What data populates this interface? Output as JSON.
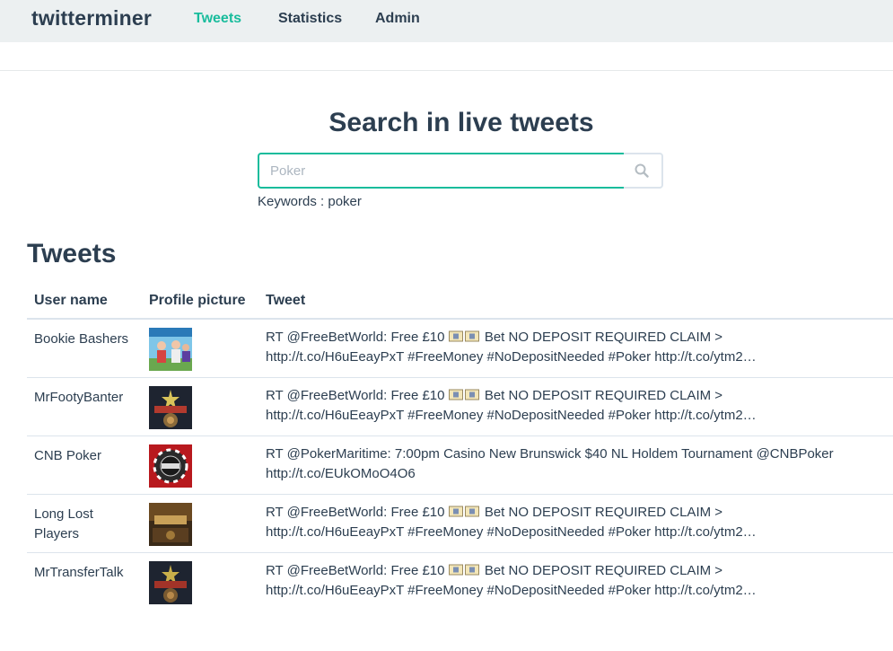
{
  "navbar": {
    "brand": "twitterminer",
    "links": [
      {
        "label": "Tweets",
        "active": true
      },
      {
        "label": "Statistics",
        "active": false
      },
      {
        "label": "Admin",
        "active": false
      }
    ]
  },
  "search": {
    "title": "Search in live tweets",
    "placeholder": "Poker",
    "icon": "search-icon",
    "keywords": "Keywords : poker"
  },
  "tweets": {
    "title": "Tweets",
    "columns": [
      "User name",
      "Profile picture",
      "Tweet"
    ],
    "rows": [
      {
        "user": "Bookie Bashers",
        "tweet_line1_before": "RT @FreeBetWorld: Free £10",
        "tweet_line1_after": "Bet NO DEPOSIT REQUIRED CLAIM >",
        "tweet_line2": "http://t.co/H6uEeayPxT #FreeMoney #NoDepositNeeded #Poker http://t.co/ytm2…"
      },
      {
        "user": "MrFootyBanter",
        "tweet_line1_before": "RT @FreeBetWorld: Free £10",
        "tweet_line1_after": "Bet NO DEPOSIT REQUIRED CLAIM >",
        "tweet_line2": "http://t.co/H6uEeayPxT #FreeMoney #NoDepositNeeded #Poker http://t.co/ytm2…"
      },
      {
        "user": "CNB Poker",
        "tweet_line1_before": "RT @PokerMaritime: 7:00pm Casino New Brunswick $40 NL Holdem Tournament @CNBPoker",
        "tweet_line1_after": "",
        "tweet_line2": "http://t.co/EUkOMoO4O6"
      },
      {
        "user": "Long Lost Players",
        "tweet_line1_before": "RT @FreeBetWorld: Free £10",
        "tweet_line1_after": "Bet NO DEPOSIT REQUIRED CLAIM >",
        "tweet_line2": "http://t.co/H6uEeayPxT #FreeMoney #NoDepositNeeded #Poker http://t.co/ytm2…"
      },
      {
        "user": "MrTransferTalk",
        "tweet_line1_before": "RT @FreeBetWorld: Free £10",
        "tweet_line1_after": "Bet NO DEPOSIT REQUIRED CLAIM >",
        "tweet_line2": "http://t.co/H6uEeayPxT #FreeMoney #NoDepositNeeded #Poker http://t.co/ytm2…"
      }
    ]
  },
  "colors": {
    "primary": "#2c3e50",
    "accent": "#18bc9c",
    "navbar_bg": "#ecf0f1",
    "border": "#dce4ec"
  }
}
